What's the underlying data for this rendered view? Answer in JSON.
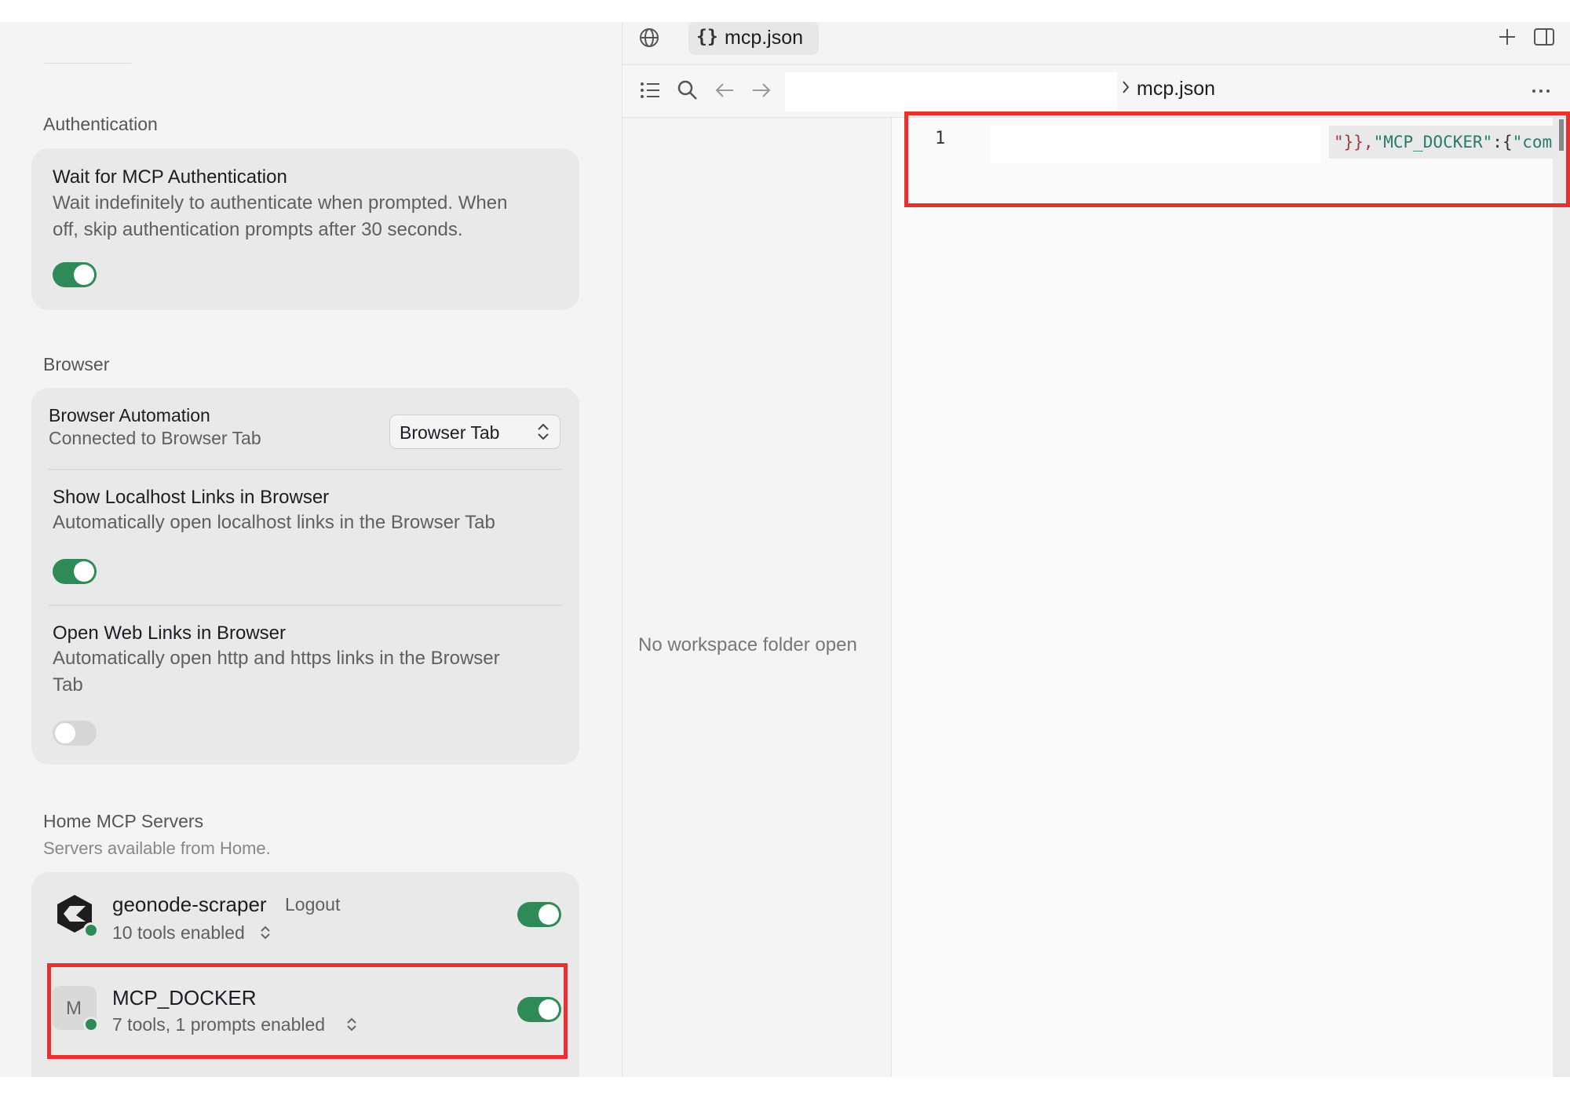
{
  "settings": {
    "authentication": {
      "section_label": "Authentication",
      "wait_title": "Wait for MCP Authentication",
      "wait_desc_line1": "Wait indefinitely to authenticate when prompted. When",
      "wait_desc_line2": "off, skip authentication prompts after 30 seconds.",
      "wait_enabled": true
    },
    "browser": {
      "section_label": "Browser",
      "automation_title": "Browser Automation",
      "automation_status": "Connected to Browser Tab",
      "automation_select_value": "Browser Tab",
      "localhost_title": "Show Localhost Links in Browser",
      "localhost_desc": "Automatically open localhost links in the Browser Tab",
      "localhost_enabled": true,
      "weblinks_title": "Open Web Links in Browser",
      "weblinks_desc_line1": "Automatically open http and https links in the Browser",
      "weblinks_desc_line2": "Tab",
      "weblinks_enabled": false
    },
    "mcp_servers": {
      "section_label": "Home MCP Servers",
      "section_sub": "Servers available from Home.",
      "servers": [
        {
          "name": "geonode-scraper",
          "action": "Logout",
          "status": "10 tools enabled",
          "enabled": true
        },
        {
          "name": "MCP_DOCKER",
          "avatar_letter": "M",
          "status": "7 tools, 1 prompts enabled",
          "enabled": true
        }
      ]
    }
  },
  "editor": {
    "tab_icon": "{}",
    "tab_name": "mcp.json",
    "breadcrumb_file": "mcp.json",
    "explorer_message": "No workspace folder open",
    "line_number": "1",
    "code_fragment_1": "\"}},",
    "code_fragment_2": "\"MCP_DOCKER\"",
    "code_fragment_3": ":{",
    "code_fragment_4": "\"com",
    "colors": {
      "accent_toggle": "#2e8b57",
      "highlight_box": "#e8302e",
      "json_key": "#2a7a6b"
    }
  }
}
